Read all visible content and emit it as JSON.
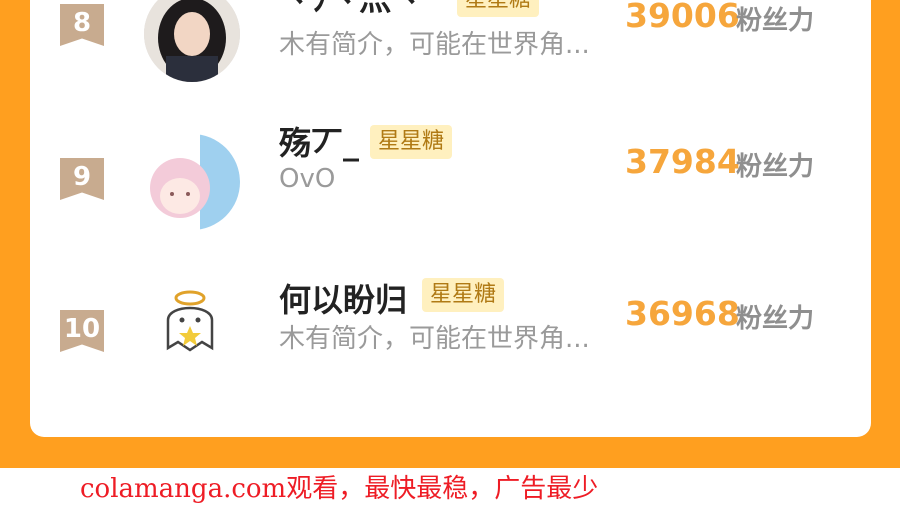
{
  "colors": {
    "background": "#ff9f1f",
    "card": "#ffffff",
    "rank_badge": "#c8ab8f",
    "tag_bg": "#fff0bf",
    "tag_text": "#b07a15",
    "score": "#f6a63c",
    "footer_text": "#ee1c25"
  },
  "ranking": {
    "score_unit": "粉丝力",
    "tag": "星星糖",
    "rows": [
      {
        "rank": "8",
        "name": "丶ﾌ丶灬丶",
        "bio": "木有简介，可能在世界角...",
        "score": "39006",
        "avatar_icon": "girl-photo-avatar-icon"
      },
      {
        "rank": "9",
        "name": "殇丆_",
        "bio": "OvO",
        "score": "37984",
        "avatar_icon": "anime-character-avatar-icon"
      },
      {
        "rank": "10",
        "name": "何以盼归",
        "bio": "木有简介，可能在世界角...",
        "score": "36968",
        "avatar_icon": "angel-ghost-avatar-icon"
      }
    ]
  },
  "footer": {
    "text": "colamanga.com观看，最快最稳，广告最少"
  }
}
